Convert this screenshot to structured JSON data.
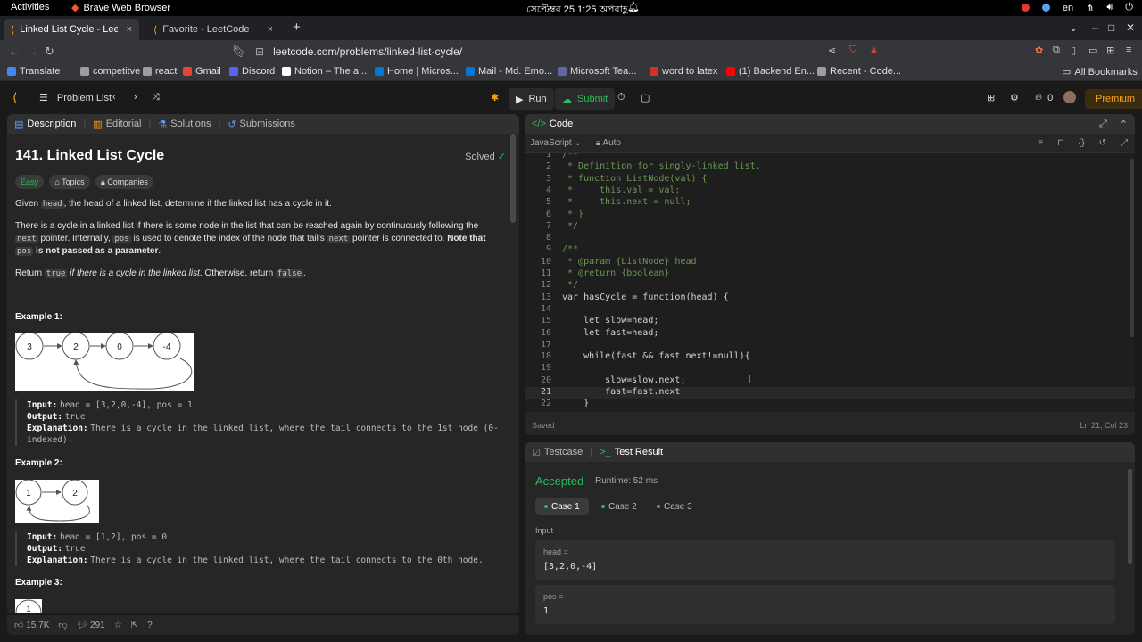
{
  "os": {
    "activities": "Activities",
    "app_name": "Brave Web Browser",
    "clock": "সেপ্টেম্বর 25  1:25 অপরাহ্ণ",
    "lang": "en"
  },
  "browser": {
    "tabs": [
      {
        "label": "Linked List Cycle - LeetC",
        "close": "×"
      },
      {
        "label": "Favorite - LeetCode",
        "close": "×"
      }
    ],
    "new_tab": "+",
    "url": "leetcode.com/problems/linked-list-cycle/",
    "bookmarks": [
      {
        "label": "Translate",
        "color": "#4285f4"
      },
      {
        "label": "competitve",
        "color": "#9e9e9e"
      },
      {
        "label": "react",
        "color": "#9e9e9e"
      },
      {
        "label": "Gmail",
        "color": "#ea4335"
      },
      {
        "label": "Discord",
        "color": "#5865f2"
      },
      {
        "label": "Notion – The a...",
        "color": "#ffffff"
      },
      {
        "label": "Home | Micros...",
        "color": "#0078d4"
      },
      {
        "label": "Mail - Md. Emo...",
        "color": "#0078d4"
      },
      {
        "label": "Microsoft Tea...",
        "color": "#6264a7"
      },
      {
        "label": "word to latex",
        "color": "#d32f2f"
      },
      {
        "label": "(1) Backend En...",
        "color": "#ff0000"
      },
      {
        "label": "Recent - Code...",
        "color": "#9e9e9e"
      }
    ],
    "all_bookmarks": "All Bookmarks"
  },
  "lc": {
    "problem_list": "Problem List",
    "run": "Run",
    "submit": "Submit",
    "streak": "0",
    "premium": "Premium"
  },
  "desc": {
    "tabs": [
      "Description",
      "Editorial",
      "Solutions",
      "Submissions"
    ],
    "title": "141. Linked List Cycle",
    "solved": "Solved",
    "chips": [
      "Easy",
      "Topics",
      "Companies"
    ],
    "p1": {
      "a": "Given ",
      "code": "head",
      "b": ", the head of a linked list, determine if the linked list has a cycle in it."
    },
    "p2": {
      "a": "There is a cycle in a linked list if there is some node in the list that can be reached again by continuously following the ",
      "code1": "next",
      "b": " pointer. Internally, ",
      "code2": "pos",
      "c": " is used to denote the index of the node that tail's ",
      "code3": "next",
      "d": " pointer is connected to. ",
      "bold1": "Note that ",
      "code4": "pos",
      "bold2": " is not passed as a parameter",
      "e": "."
    },
    "p3": {
      "a": "Return ",
      "code1": "true",
      "b": " if there is a cycle in the linked list",
      "c": ". Otherwise, return ",
      "code2": "false",
      "d": "."
    },
    "examples": [
      {
        "heading": "Example 1:",
        "nodes": [
          "3",
          "2",
          "0",
          "-4"
        ],
        "input_label": "Input:",
        "input": "head = [3,2,0,-4], pos = 1",
        "output_label": "Output:",
        "output": "true",
        "expl_label": "Explanation:",
        "expl": "There is a cycle in the linked list, where the tail connects to the 1st node (0-indexed)."
      },
      {
        "heading": "Example 2:",
        "nodes": [
          "1",
          "2"
        ],
        "input_label": "Input:",
        "input": "head = [1,2], pos = 0",
        "output_label": "Output:",
        "output": "true",
        "expl_label": "Explanation:",
        "expl": "There is a cycle in the linked list, where the tail connects to the 0th node."
      },
      {
        "heading": "Example 3:",
        "nodes": [
          "1"
        ]
      }
    ],
    "footer": {
      "likes": "15.7K",
      "comments": "291"
    }
  },
  "code": {
    "title": "Code",
    "language": "JavaScript",
    "mode": "Auto",
    "status_left": "Saved",
    "status_right": "Ln 21, Col 23",
    "lines": [
      {
        "n": "1",
        "t": "/**"
      },
      {
        "n": "2",
        "t": " * Definition for singly-linked list."
      },
      {
        "n": "3",
        "t": " * function ListNode(val) {"
      },
      {
        "n": "4",
        "t": " *     this.val = val;"
      },
      {
        "n": "5",
        "t": " *     this.next = null;"
      },
      {
        "n": "6",
        "t": " * }"
      },
      {
        "n": "7",
        "t": " */"
      },
      {
        "n": "8",
        "t": ""
      },
      {
        "n": "9",
        "t": "/**"
      },
      {
        "n": "10",
        "t": " * @param {ListNode} head"
      },
      {
        "n": "11",
        "t": " * @return {boolean}"
      },
      {
        "n": "12",
        "t": " */"
      },
      {
        "n": "13",
        "t": "var hasCycle = function(head) {"
      },
      {
        "n": "14",
        "t": ""
      },
      {
        "n": "15",
        "t": "    let slow=head;"
      },
      {
        "n": "16",
        "t": "    let fast=head;"
      },
      {
        "n": "17",
        "t": ""
      },
      {
        "n": "18",
        "t": "    while(fast && fast.next!=null){"
      },
      {
        "n": "19",
        "t": ""
      },
      {
        "n": "20",
        "t": "        slow=slow.next;"
      },
      {
        "n": "21",
        "t": "        fast=fast.next"
      },
      {
        "n": "22",
        "t": "    }"
      }
    ]
  },
  "result": {
    "tabs": [
      "Testcase",
      "Test Result"
    ],
    "status": "Accepted",
    "runtime": "Runtime: 52 ms",
    "cases": [
      "Case 1",
      "Case 2",
      "Case 3"
    ],
    "input_label": "Input",
    "inputs": [
      {
        "name": "head =",
        "value": "[3,2,0,-4]"
      },
      {
        "name": "pos =",
        "value": "1"
      }
    ]
  }
}
